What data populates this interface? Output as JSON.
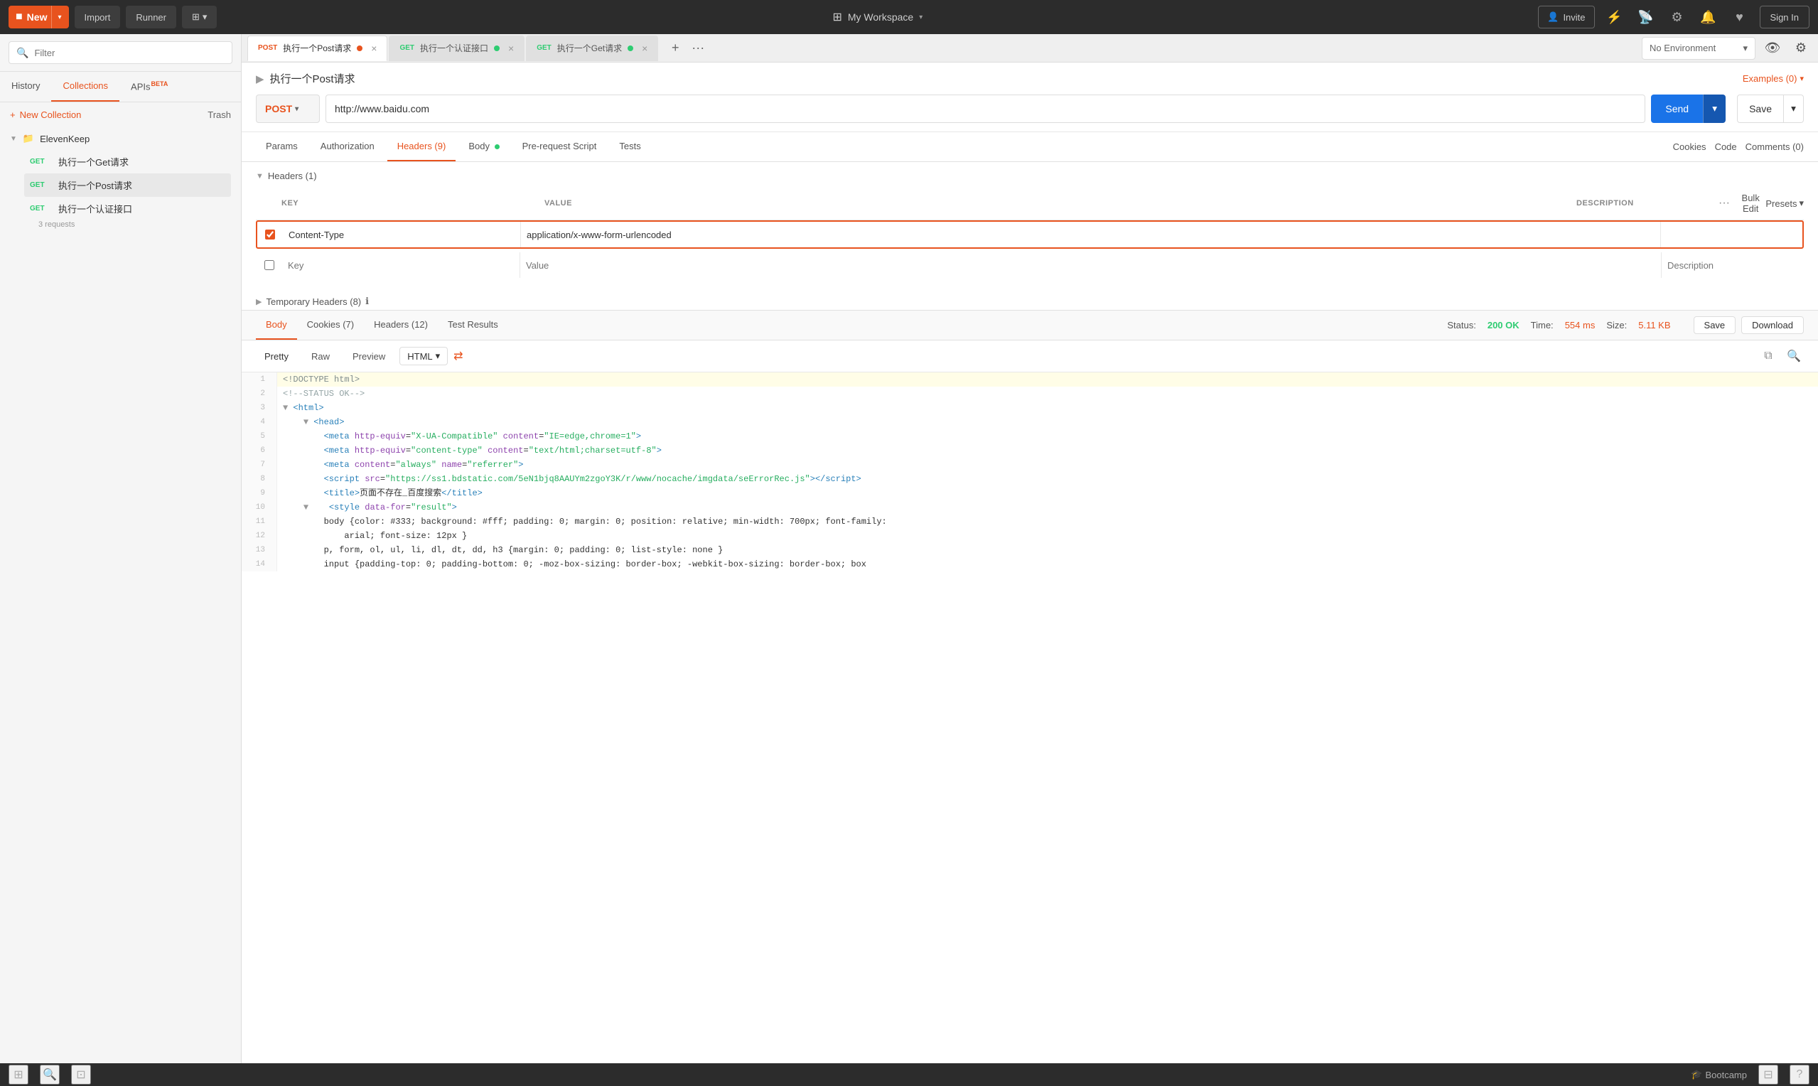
{
  "topbar": {
    "new_label": "New",
    "import_label": "Import",
    "runner_label": "Runner",
    "workspace_label": "My Workspace",
    "invite_label": "Invite",
    "sign_in_label": "Sign In"
  },
  "sidebar": {
    "search_placeholder": "Filter",
    "tabs": [
      {
        "id": "history",
        "label": "History",
        "active": false
      },
      {
        "id": "collections",
        "label": "Collections",
        "active": true
      },
      {
        "id": "apis",
        "label": "APIs",
        "beta": true,
        "active": false
      }
    ],
    "new_collection_label": "New Collection",
    "trash_label": "Trash",
    "collection": {
      "name": "ElevenKeep",
      "count": "3 requests",
      "requests": [
        {
          "method": "GET",
          "name": "执行一个Get请求",
          "active": false
        },
        {
          "method": "GET",
          "name": "执行一个Post请求",
          "active": true
        },
        {
          "method": "GET",
          "name": "执行一个认证接口",
          "active": false
        }
      ]
    }
  },
  "tabs": [
    {
      "method": "POST",
      "name": "执行一个Post请求",
      "has_dot": true,
      "dot_type": "post",
      "active": true
    },
    {
      "method": "GET",
      "name": "执行一个认证接口",
      "has_dot": true,
      "dot_type": "get",
      "active": false
    },
    {
      "method": "GET",
      "name": "执行一个Get请求",
      "has_dot": true,
      "dot_type": "get",
      "active": false
    }
  ],
  "request": {
    "title": "执行一个Post请求",
    "examples_label": "Examples (0)",
    "method": "POST",
    "url": "http://www.baidu.com",
    "send_label": "Send",
    "save_label": "Save"
  },
  "request_tabs": [
    {
      "label": "Params",
      "active": false
    },
    {
      "label": "Authorization",
      "active": false
    },
    {
      "label": "Headers (9)",
      "active": true
    },
    {
      "label": "Body",
      "dot": true,
      "active": false
    },
    {
      "label": "Pre-request Script",
      "active": false
    },
    {
      "label": "Tests",
      "active": false
    }
  ],
  "request_tab_links": [
    {
      "label": "Cookies",
      "active": false
    },
    {
      "label": "Code",
      "active": false
    },
    {
      "label": "Comments (0)",
      "active": false
    }
  ],
  "headers": {
    "title": "Headers (1)",
    "columns": {
      "key": "KEY",
      "value": "VALUE",
      "description": "DESCRIPTION"
    },
    "bulk_edit": "Bulk Edit",
    "presets": "Presets",
    "rows": [
      {
        "checked": true,
        "key": "Content-Type",
        "value": "application/x-www-form-urlencoded",
        "description": "",
        "highlighted": true
      },
      {
        "checked": false,
        "key": "Key",
        "value": "Value",
        "description": "Description",
        "highlighted": false
      }
    ],
    "temp_label": "Temporary Headers (8)"
  },
  "response": {
    "tabs": [
      {
        "label": "Body",
        "active": true
      },
      {
        "label": "Cookies (7)",
        "active": false
      },
      {
        "label": "Headers (12)",
        "active": false
      },
      {
        "label": "Test Results",
        "active": false
      }
    ],
    "status_label": "Status:",
    "status_value": "200 OK",
    "time_label": "Time:",
    "time_value": "554 ms",
    "size_label": "Size:",
    "size_value": "5.11 KB",
    "save_label": "Save",
    "download_label": "Download",
    "format_tabs": [
      {
        "label": "Pretty",
        "active": true
      },
      {
        "label": "Raw",
        "active": false
      },
      {
        "label": "Preview",
        "active": false
      }
    ],
    "format_select": "HTML",
    "code_lines": [
      {
        "num": 1,
        "content": "<!DOCTYPE html>"
      },
      {
        "num": 2,
        "content": "<!--STATUS OK-->"
      },
      {
        "num": 3,
        "content": "<html>"
      },
      {
        "num": 4,
        "content": "    <head>"
      },
      {
        "num": 5,
        "content": "        <meta http-equiv=\"X-UA-Compatible\" content=\"IE=edge,chrome=1\">"
      },
      {
        "num": 6,
        "content": "        <meta http-equiv=\"content-type\" content=\"text/html;charset=utf-8\">"
      },
      {
        "num": 7,
        "content": "        <meta content=\"always\" name=\"referrer\">"
      },
      {
        "num": 8,
        "content": "        <script src=\"https://ss1.bdstatic.com/5eN1bjq8AAUYm2zgoY3K/r/www/nocache/imgdata/seErrorRec.js\"><\\/script>"
      },
      {
        "num": 9,
        "content": "        <title>页面不存在_百度搜索</title>"
      },
      {
        "num": 10,
        "content": "        <style data-for=\"result\">"
      },
      {
        "num": 11,
        "content": "        body {color: #333; background: #fff; padding: 0; margin: 0; position: relative; min-width: 700px; font-family:"
      },
      {
        "num": 12,
        "content": "            arial; font-size: 12px }"
      },
      {
        "num": 13,
        "content": "        p, form, ol, ul, li, dl, dt, dd, h3 {margin: 0; padding: 0; list-style: none }"
      },
      {
        "num": 14,
        "content": "        input {padding-top: 0; padding-bottom: 0; -moz-box-sizing: border-box; -webkit-box-sizing: border-box; box"
      }
    ]
  },
  "environment": {
    "label": "No Environment"
  },
  "bottom": {
    "bootcamp_label": "Bootcamp"
  }
}
